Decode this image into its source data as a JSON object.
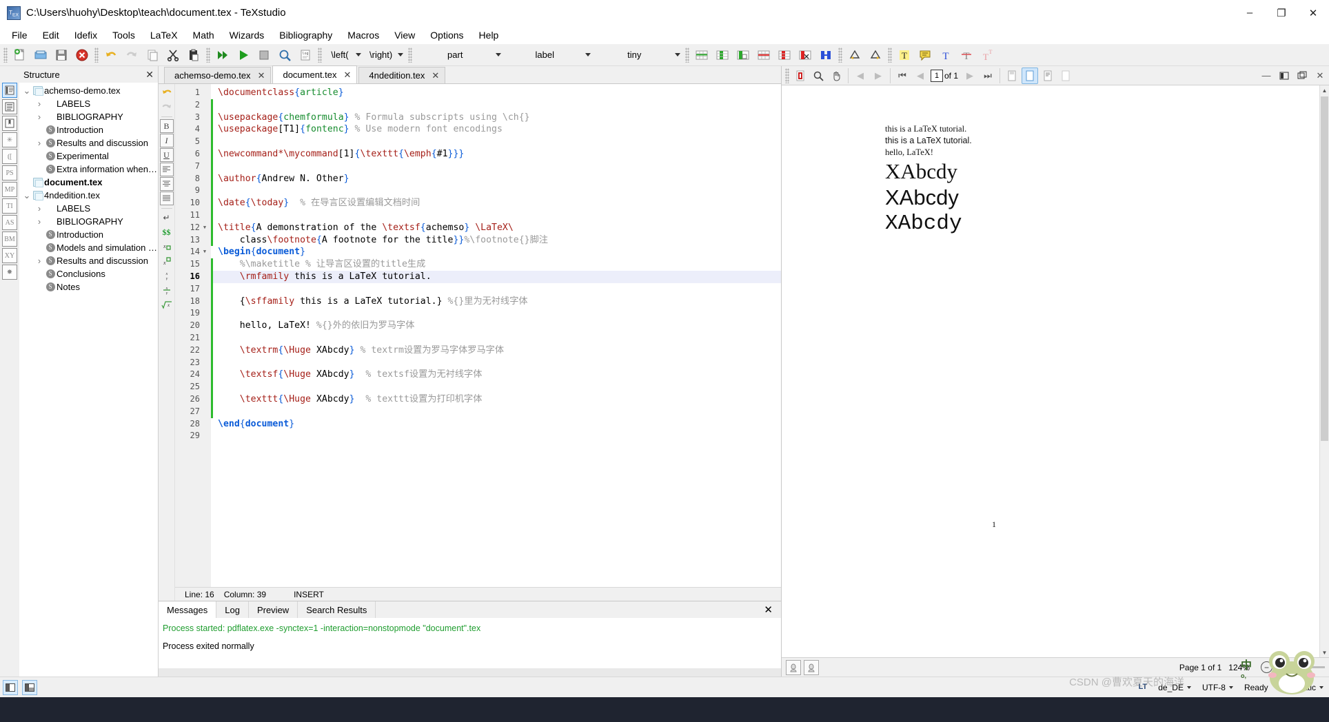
{
  "window": {
    "title": "C:\\Users\\huohy\\Desktop\\teach\\document.tex - TeXstudio",
    "app_icon": "texstudio-icon",
    "minimize": "–",
    "maximize": "❐",
    "close": "✕"
  },
  "menubar": {
    "items": [
      {
        "label": "File"
      },
      {
        "label": "Edit"
      },
      {
        "label": "Idefix"
      },
      {
        "label": "Tools"
      },
      {
        "label": "LaTeX"
      },
      {
        "label": "Math"
      },
      {
        "label": "Wizards"
      },
      {
        "label": "Bibliography"
      },
      {
        "label": "Macros"
      },
      {
        "label": "View"
      },
      {
        "label": "Options"
      },
      {
        "label": "Help"
      }
    ]
  },
  "toolbar": {
    "combos": [
      {
        "name": "left-delimiter",
        "value": "\\left("
      },
      {
        "name": "right-delimiter",
        "value": "\\right)"
      },
      {
        "name": "section-level",
        "value": "part"
      },
      {
        "name": "reference-type",
        "value": "label"
      },
      {
        "name": "font-size",
        "value": "tiny"
      }
    ]
  },
  "structure": {
    "title": "Structure",
    "close_label": "✕",
    "side_buttons": [
      "structure-view",
      "list-view",
      "bookmarks-view",
      "symbols-view",
      "brackets-view",
      "PS",
      "MP",
      "TI",
      "AS",
      "BM",
      "XY",
      "misc-symbols"
    ],
    "tree": [
      {
        "indent": 0,
        "expander": "v",
        "icon": "document",
        "label": "achemso-demo.tex",
        "bold": false
      },
      {
        "indent": 1,
        "expander": ">",
        "icon": "none",
        "label": "LABELS",
        "bold": false
      },
      {
        "indent": 1,
        "expander": ">",
        "icon": "none",
        "label": "BIBLIOGRAPHY",
        "bold": false
      },
      {
        "indent": 1,
        "expander": "",
        "icon": "section",
        "label": "Introduction",
        "bold": false
      },
      {
        "indent": 1,
        "expander": ">",
        "icon": "section",
        "label": "Results and discussion",
        "bold": false
      },
      {
        "indent": 1,
        "expander": "",
        "icon": "section",
        "label": "Experimental",
        "bold": false
      },
      {
        "indent": 1,
        "expander": "",
        "icon": "section",
        "label": "Extra information when writin...",
        "bold": false
      },
      {
        "indent": 0,
        "expander": "",
        "icon": "document",
        "label": "document.tex",
        "bold": true
      },
      {
        "indent": 0,
        "expander": "v",
        "icon": "document",
        "label": "4ndedition.tex",
        "bold": false
      },
      {
        "indent": 1,
        "expander": ">",
        "icon": "none",
        "label": "LABELS",
        "bold": false
      },
      {
        "indent": 1,
        "expander": ">",
        "icon": "none",
        "label": "BIBLIOGRAPHY",
        "bold": false
      },
      {
        "indent": 1,
        "expander": "",
        "icon": "section",
        "label": "Introduction",
        "bold": false
      },
      {
        "indent": 1,
        "expander": "",
        "icon": "section",
        "label": "Models and simulation metho...",
        "bold": false
      },
      {
        "indent": 1,
        "expander": ">",
        "icon": "section",
        "label": "Results and discussion",
        "bold": false
      },
      {
        "indent": 1,
        "expander": "",
        "icon": "section",
        "label": "Conclusions",
        "bold": false
      },
      {
        "indent": 1,
        "expander": "",
        "icon": "section",
        "label": "Notes",
        "bold": false
      }
    ]
  },
  "editor": {
    "tabs": [
      {
        "label": "achemso-demo.tex",
        "active": false,
        "close": "✕"
      },
      {
        "label": "document.tex",
        "active": true,
        "close": "✕"
      },
      {
        "label": "4ndedition.tex",
        "active": false,
        "close": "✕"
      }
    ],
    "side_tools": [
      "undo-arrow",
      "redo-arrow",
      "bold",
      "italic",
      "underline",
      "align-left",
      "align-center",
      "align-justify",
      "newline",
      "math-display",
      "subscript",
      "superscript",
      "fraction",
      "dfrac",
      "sqrt"
    ],
    "current_line": 16,
    "status": {
      "line_label": "Line: 16",
      "column_label": "Column: 39",
      "mode_label": "INSERT"
    },
    "lines": [
      {
        "n": 1,
        "fold": "",
        "mark": false,
        "cur": false,
        "tokens": [
          {
            "t": "cmd",
            "s": "\\documentclass"
          },
          {
            "t": "brc",
            "s": "{"
          },
          {
            "t": "arg",
            "s": "article"
          },
          {
            "t": "brc",
            "s": "}"
          }
        ]
      },
      {
        "n": 2,
        "fold": "",
        "mark": true,
        "cur": false,
        "tokens": []
      },
      {
        "n": 3,
        "fold": "",
        "mark": true,
        "cur": false,
        "tokens": [
          {
            "t": "cmd",
            "s": "\\usepackage"
          },
          {
            "t": "brc",
            "s": "{"
          },
          {
            "t": "arg",
            "s": "chemformula"
          },
          {
            "t": "brc",
            "s": "}"
          },
          {
            "t": "cmt",
            "s": " % Formula subscripts using \\ch{}"
          }
        ]
      },
      {
        "n": 4,
        "fold": "",
        "mark": true,
        "cur": false,
        "tokens": [
          {
            "t": "cmd",
            "s": "\\usepackage"
          },
          {
            "t": "txt",
            "s": "[T1]"
          },
          {
            "t": "brc",
            "s": "{"
          },
          {
            "t": "arg",
            "s": "fontenc"
          },
          {
            "t": "brc",
            "s": "}"
          },
          {
            "t": "cmt",
            "s": " % Use modern font encodings"
          }
        ]
      },
      {
        "n": 5,
        "fold": "",
        "mark": true,
        "cur": false,
        "tokens": []
      },
      {
        "n": 6,
        "fold": "",
        "mark": true,
        "cur": false,
        "tokens": [
          {
            "t": "cmd",
            "s": "\\newcommand*\\mycommand"
          },
          {
            "t": "txt",
            "s": "[1]"
          },
          {
            "t": "brc",
            "s": "{"
          },
          {
            "t": "cmd",
            "s": "\\texttt"
          },
          {
            "t": "brc",
            "s": "{"
          },
          {
            "t": "cmd",
            "s": "\\emph"
          },
          {
            "t": "brc",
            "s": "{"
          },
          {
            "t": "txt",
            "s": "#1"
          },
          {
            "t": "brc",
            "s": "}}}"
          }
        ]
      },
      {
        "n": 7,
        "fold": "",
        "mark": true,
        "cur": false,
        "tokens": []
      },
      {
        "n": 8,
        "fold": "",
        "mark": true,
        "cur": false,
        "tokens": [
          {
            "t": "cmd",
            "s": "\\author"
          },
          {
            "t": "brc",
            "s": "{"
          },
          {
            "t": "txt",
            "s": "Andrew N. Other"
          },
          {
            "t": "brc",
            "s": "}"
          }
        ]
      },
      {
        "n": 9,
        "fold": "",
        "mark": true,
        "cur": false,
        "tokens": []
      },
      {
        "n": 10,
        "fold": "",
        "mark": true,
        "cur": false,
        "tokens": [
          {
            "t": "cmd",
            "s": "\\date"
          },
          {
            "t": "brc",
            "s": "{"
          },
          {
            "t": "cmd",
            "s": "\\today"
          },
          {
            "t": "brc",
            "s": "}"
          },
          {
            "t": "cmt",
            "s": "  % 在导言区设置编辑文档时间"
          }
        ]
      },
      {
        "n": 11,
        "fold": "",
        "mark": true,
        "cur": false,
        "tokens": []
      },
      {
        "n": 12,
        "fold": "v",
        "mark": true,
        "cur": false,
        "tokens": [
          {
            "t": "cmd",
            "s": "\\title"
          },
          {
            "t": "brc",
            "s": "{"
          },
          {
            "t": "txt",
            "s": "A demonstration of the "
          },
          {
            "t": "cmd",
            "s": "\\textsf"
          },
          {
            "t": "brc",
            "s": "{"
          },
          {
            "t": "txt",
            "s": "achemso"
          },
          {
            "t": "brc",
            "s": "}"
          },
          {
            "t": "cmd",
            "s": " \\LaTeX\\"
          }
        ]
      },
      {
        "n": 13,
        "fold": "",
        "mark": true,
        "cur": false,
        "tokens": [
          {
            "t": "txt",
            "s": "    class"
          },
          {
            "t": "cmd",
            "s": "\\footnote"
          },
          {
            "t": "brc",
            "s": "{"
          },
          {
            "t": "txt",
            "s": "A footnote for the title"
          },
          {
            "t": "brc",
            "s": "}}"
          },
          {
            "t": "cmt",
            "s": "%\\footnote{}脚注"
          }
        ]
      },
      {
        "n": 14,
        "fold": "v",
        "mark": false,
        "cur": false,
        "tokens": [
          {
            "t": "kw",
            "s": "\\begin"
          },
          {
            "t": "brc",
            "s": "{"
          },
          {
            "t": "kw",
            "s": "document"
          },
          {
            "t": "brc",
            "s": "}"
          }
        ]
      },
      {
        "n": 15,
        "fold": "",
        "mark": true,
        "cur": false,
        "tokens": [
          {
            "t": "cmt",
            "s": "    %\\maketitle % 让导言区设置的title生成"
          }
        ]
      },
      {
        "n": 16,
        "fold": "",
        "mark": true,
        "cur": true,
        "tokens": [
          {
            "t": "cmd",
            "s": "    \\rmfamily"
          },
          {
            "t": "txt",
            "s": " this is a LaTeX tutorial."
          }
        ]
      },
      {
        "n": 17,
        "fold": "",
        "mark": true,
        "cur": false,
        "tokens": []
      },
      {
        "n": 18,
        "fold": "",
        "mark": true,
        "cur": false,
        "tokens": [
          {
            "t": "txt",
            "s": "    {"
          },
          {
            "t": "cmd",
            "s": "\\sffamily"
          },
          {
            "t": "txt",
            "s": " this is a LaTeX tutorial.}"
          },
          {
            "t": "cmt",
            "s": " %{}里为无衬线字体"
          }
        ]
      },
      {
        "n": 19,
        "fold": "",
        "mark": true,
        "cur": false,
        "tokens": []
      },
      {
        "n": 20,
        "fold": "",
        "mark": true,
        "cur": false,
        "tokens": [
          {
            "t": "txt",
            "s": "    hello, LaTeX!"
          },
          {
            "t": "cmt",
            "s": " %{}外的依旧为罗马字体"
          }
        ]
      },
      {
        "n": 21,
        "fold": "",
        "mark": true,
        "cur": false,
        "tokens": []
      },
      {
        "n": 22,
        "fold": "",
        "mark": true,
        "cur": false,
        "tokens": [
          {
            "t": "cmd",
            "s": "    \\textrm"
          },
          {
            "t": "brc",
            "s": "{"
          },
          {
            "t": "cmd",
            "s": "\\Huge"
          },
          {
            "t": "txt",
            "s": " XAbcdy"
          },
          {
            "t": "brc",
            "s": "}"
          },
          {
            "t": "cmt",
            "s": " % textrm设置为罗马字体罗马字体"
          }
        ]
      },
      {
        "n": 23,
        "fold": "",
        "mark": true,
        "cur": false,
        "tokens": []
      },
      {
        "n": 24,
        "fold": "",
        "mark": true,
        "cur": false,
        "tokens": [
          {
            "t": "cmd",
            "s": "    \\textsf"
          },
          {
            "t": "brc",
            "s": "{"
          },
          {
            "t": "cmd",
            "s": "\\Huge"
          },
          {
            "t": "txt",
            "s": " XAbcdy"
          },
          {
            "t": "brc",
            "s": "}"
          },
          {
            "t": "cmt",
            "s": "  % textsf设置为无衬线字体"
          }
        ]
      },
      {
        "n": 25,
        "fold": "",
        "mark": true,
        "cur": false,
        "tokens": []
      },
      {
        "n": 26,
        "fold": "",
        "mark": true,
        "cur": false,
        "tokens": [
          {
            "t": "cmd",
            "s": "    \\texttt"
          },
          {
            "t": "brc",
            "s": "{"
          },
          {
            "t": "cmd",
            "s": "\\Huge"
          },
          {
            "t": "txt",
            "s": " XAbcdy"
          },
          {
            "t": "brc",
            "s": "}"
          },
          {
            "t": "cmt",
            "s": "  % texttt设置为打印机字体"
          }
        ]
      },
      {
        "n": 27,
        "fold": "",
        "mark": true,
        "cur": false,
        "tokens": []
      },
      {
        "n": 28,
        "fold": "",
        "mark": false,
        "cur": false,
        "tokens": [
          {
            "t": "kw",
            "s": "\\end"
          },
          {
            "t": "brc",
            "s": "{"
          },
          {
            "t": "kw",
            "s": "document"
          },
          {
            "t": "brc",
            "s": "}"
          }
        ]
      },
      {
        "n": 29,
        "fold": "",
        "mark": false,
        "cur": false,
        "tokens": []
      }
    ]
  },
  "messages": {
    "tabs": [
      {
        "label": "Messages",
        "active": true
      },
      {
        "label": "Log",
        "active": false
      },
      {
        "label": "Preview",
        "active": false
      },
      {
        "label": "Search Results",
        "active": false
      }
    ],
    "close_label": "✕",
    "lines": [
      {
        "text": "Process started: pdflatex.exe -synctex=1 -interaction=nonstopmode \"document\".tex",
        "style": "ok"
      },
      {
        "text": "Process exited normally",
        "style": "normal"
      }
    ]
  },
  "pdf": {
    "toolbar": {
      "page_value": "1",
      "of_label": "of 1",
      "buttons": [
        "pdf-icon",
        "magnify-icon",
        "hand-icon",
        "back-arrow-icon",
        "forward-arrow-icon",
        "first-page-icon",
        "prev-page-icon",
        "next-page-icon",
        "last-page-icon",
        "fit-width-icon",
        "fit-page-icon",
        "continuous-icon",
        "single-page-icon"
      ],
      "right_buttons": [
        "minimize-icon",
        "dock-left-icon",
        "float-icon",
        "close-icon"
      ]
    },
    "page_content": [
      {
        "text": "this is a LaTeX tutorial.",
        "style": "rm",
        "size": "small"
      },
      {
        "text": "this is a LaTeX tutorial.",
        "style": "sf",
        "size": "small"
      },
      {
        "text": "hello, LaTeX!",
        "style": "rm",
        "size": "small"
      },
      {
        "text": "XAbcdy",
        "style": "rm",
        "size": "huge"
      },
      {
        "text": "XAbcdy",
        "style": "sf",
        "size": "huge"
      },
      {
        "text": "XAbcdy",
        "style": "tt",
        "size": "huge"
      }
    ],
    "page_number": "1",
    "status": {
      "page_label": "Page 1 of 1",
      "zoom_label": "124%",
      "zoom_out": "⊖",
      "tool_left": "prev-annotation-icon",
      "tool_right": "next-annotation-icon"
    }
  },
  "bottombar": {
    "layout_buttons": [
      "layout-left-icon",
      "layout-left-bottom-icon"
    ],
    "right_items": [
      {
        "name": "languagetool-indicator",
        "label": "LT"
      },
      {
        "name": "language-selector",
        "label": "de_DE",
        "arrow": true
      },
      {
        "name": "encoding-selector",
        "label": "UTF-8",
        "arrow": true
      },
      {
        "name": "ready-status",
        "label": "Ready"
      },
      {
        "name": "mode-selector",
        "label": "Automatic",
        "arrow": true
      }
    ]
  },
  "overlay": {
    "watermark": "CSDN @曹欢夏天的海洋",
    "ime_main": "中",
    "ime_sub": "o,"
  }
}
